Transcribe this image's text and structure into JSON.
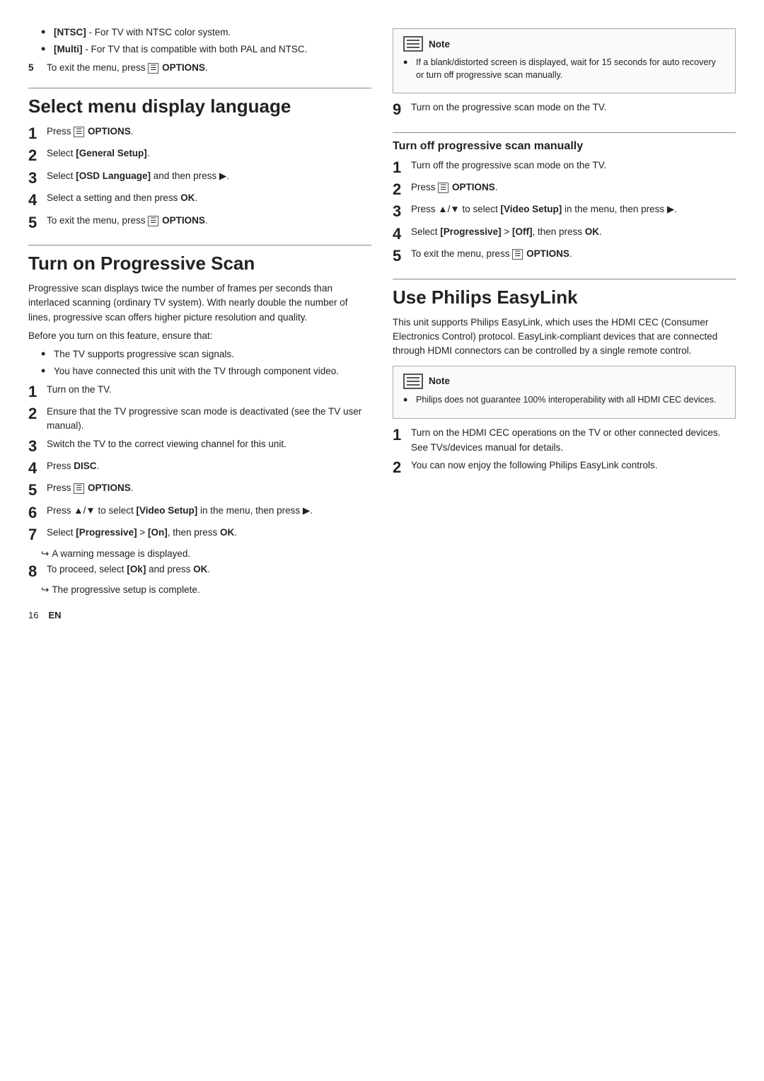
{
  "top_bullets": {
    "items": [
      {
        "label": "[NTSC]",
        "desc": "- For TV with NTSC color system."
      },
      {
        "label": "[Multi]",
        "desc": "- For TV that is compatible with both PAL and NTSC."
      }
    ],
    "step5": "To exit the menu, press",
    "step5_btn": "OPTIONS",
    "step5_icon": true
  },
  "select_menu": {
    "title": "Select menu display language",
    "steps": [
      {
        "num": "1",
        "text": "Press",
        "btn": "OPTIONS",
        "icon": true
      },
      {
        "num": "2",
        "text": "Select [General Setup]."
      },
      {
        "num": "3",
        "text": "Select [OSD Language] and then press ▶."
      },
      {
        "num": "4",
        "text": "Select a setting and then press OK."
      },
      {
        "num": "5",
        "text": "To exit the menu, press",
        "btn": "OPTIONS",
        "icon": true
      }
    ]
  },
  "progressive_scan": {
    "title": "Turn on Progressive Scan",
    "desc1": "Progressive scan displays twice the number of frames per seconds than interlaced scanning (ordinary TV system). With nearly double the number of lines, progressive scan offers higher picture resolution and quality.",
    "desc2": "Before you turn on this feature, ensure that:",
    "bullets": [
      "The TV supports progressive scan signals.",
      "You have connected this unit with the TV through component video."
    ],
    "steps": [
      {
        "num": "1",
        "text": "Turn on the TV."
      },
      {
        "num": "2",
        "text": "Ensure that the TV progressive scan mode is deactivated (see the TV user manual)."
      },
      {
        "num": "3",
        "text": "Switch the TV to the correct viewing channel for this unit."
      },
      {
        "num": "4",
        "text": "Press DISC.",
        "bold_word": "DISC"
      },
      {
        "num": "5",
        "text": "Press",
        "btn": "OPTIONS",
        "icon": true
      },
      {
        "num": "6",
        "text": "Press ▲/▼ to select [Video Setup] in the menu, then press ▶."
      },
      {
        "num": "7",
        "text": "Select [Progressive] > [On], then press OK."
      },
      {
        "num": "7a",
        "arrow": "A warning message is displayed."
      },
      {
        "num": "8",
        "text": "To proceed, select [Ok] and press OK."
      },
      {
        "num": "8a",
        "arrow": "The progressive setup is complete."
      }
    ]
  },
  "note_top_right": {
    "label": "Note",
    "bullets": [
      "If a blank/distorted screen is displayed, wait for 15 seconds for auto recovery or turn off progressive scan manually."
    ]
  },
  "step9": {
    "num": "9",
    "text": "Turn on the progressive scan mode on the TV."
  },
  "turn_off_progressive": {
    "title": "Turn off progressive scan manually",
    "steps": [
      {
        "num": "1",
        "text": "Turn off the progressive scan mode on the TV."
      },
      {
        "num": "2",
        "text": "Press",
        "btn": "OPTIONS",
        "icon": true
      },
      {
        "num": "3",
        "text": "Press ▲/▼ to select [Video Setup] in the menu, then press ▶."
      },
      {
        "num": "4",
        "text": "Select [Progressive] > [Off], then press OK."
      },
      {
        "num": "5",
        "text": "To exit the menu, press",
        "btn": "OPTIONS",
        "icon": true
      }
    ]
  },
  "easylink": {
    "title": "Use Philips EasyLink",
    "desc": "This unit supports Philips EasyLink, which uses the HDMI CEC (Consumer Electronics Control) protocol. EasyLink-compliant devices that are connected through HDMI connectors can be controlled by a single remote control.",
    "note": {
      "label": "Note",
      "bullets": [
        "Philips does not guarantee 100% interoperability with all HDMI CEC devices."
      ]
    },
    "steps": [
      {
        "num": "1",
        "text": "Turn on the HDMI CEC operations on the TV or other connected devices. See TVs/devices manual for details."
      },
      {
        "num": "2",
        "text": "You can now enjoy the following Philips EasyLink controls."
      }
    ]
  },
  "footer": {
    "page": "16",
    "lang": "EN"
  }
}
